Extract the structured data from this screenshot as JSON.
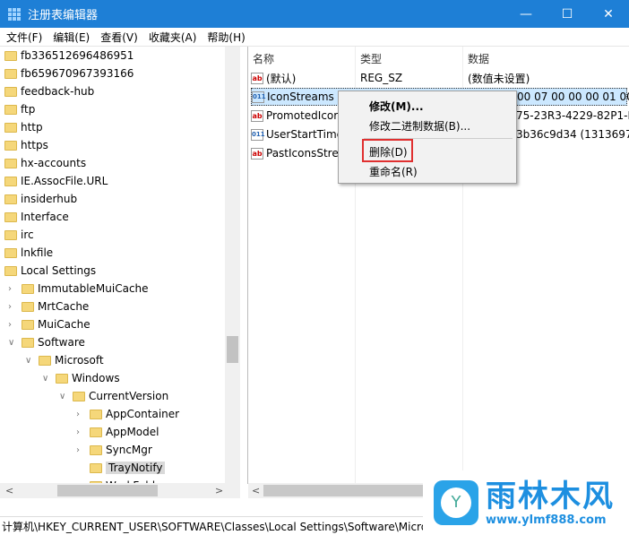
{
  "window": {
    "title": "注册表编辑器",
    "controls": {
      "minimize": "—",
      "maximize": "☐",
      "close": "✕"
    }
  },
  "menu": [
    "文件(F)",
    "编辑(E)",
    "查看(V)",
    "收藏夹(A)",
    "帮助(H)"
  ],
  "tree": [
    {
      "label": "fb336512696486951",
      "depth": 0
    },
    {
      "label": "fb659670967393166",
      "depth": 0
    },
    {
      "label": "feedback-hub",
      "depth": 0
    },
    {
      "label": "ftp",
      "depth": 0
    },
    {
      "label": "http",
      "depth": 0
    },
    {
      "label": "https",
      "depth": 0
    },
    {
      "label": "hx-accounts",
      "depth": 0
    },
    {
      "label": "IE.AssocFile.URL",
      "depth": 0
    },
    {
      "label": "insiderhub",
      "depth": 0
    },
    {
      "label": "Interface",
      "depth": 0
    },
    {
      "label": "irc",
      "depth": 0
    },
    {
      "label": "lnkfile",
      "depth": 0
    },
    {
      "label": "Local Settings",
      "depth": 0
    },
    {
      "label": "ImmutableMuiCache",
      "depth": 1,
      "expander": ">"
    },
    {
      "label": "MrtCache",
      "depth": 1,
      "expander": ">"
    },
    {
      "label": "MuiCache",
      "depth": 1,
      "expander": ">"
    },
    {
      "label": "Software",
      "depth": 1,
      "expander": "v"
    },
    {
      "label": "Microsoft",
      "depth": 2,
      "expander": "v"
    },
    {
      "label": "Windows",
      "depth": 3,
      "expander": "v"
    },
    {
      "label": "CurrentVersion",
      "depth": 4,
      "expander": "v"
    },
    {
      "label": "AppContainer",
      "depth": 5,
      "expander": ">"
    },
    {
      "label": "AppModel",
      "depth": 5,
      "expander": ">"
    },
    {
      "label": "SyncMgr",
      "depth": 5,
      "expander": ">"
    },
    {
      "label": "TrayNotify",
      "depth": 5,
      "selected": true
    },
    {
      "label": "WorkFolders",
      "depth": 5
    }
  ],
  "list": {
    "columns": [
      "名称",
      "类型",
      "数据"
    ],
    "rows": [
      {
        "icon": "ab",
        "name": "(默认)",
        "type": "REG_SZ",
        "data": "(数值未设置)"
      },
      {
        "icon": "bin",
        "name": "IconStreams",
        "type": "",
        "data": "00 07 00 00 00 01 00",
        "focused": true
      },
      {
        "icon": "ab",
        "name": "PromotedIcor",
        "type": "",
        "data": "75-23R3-4229-82P1-R"
      },
      {
        "icon": "bin",
        "name": "UserStartTime",
        "type": "",
        "data": "3b36c9d34 (1313697"
      },
      {
        "icon": "ab",
        "name": "PastIconsStre",
        "type": "",
        "data": ""
      }
    ]
  },
  "context_menu": [
    "修改(M)...",
    "修改二进制数据(B)...",
    "删除(D)",
    "重命名(R)"
  ],
  "status": "计算机\\HKEY_CURRENT_USER\\SOFTWARE\\Classes\\Local Settings\\Software\\Micros",
  "watermark": {
    "name": "雨林木风",
    "url": "www.ylmf888.com"
  }
}
